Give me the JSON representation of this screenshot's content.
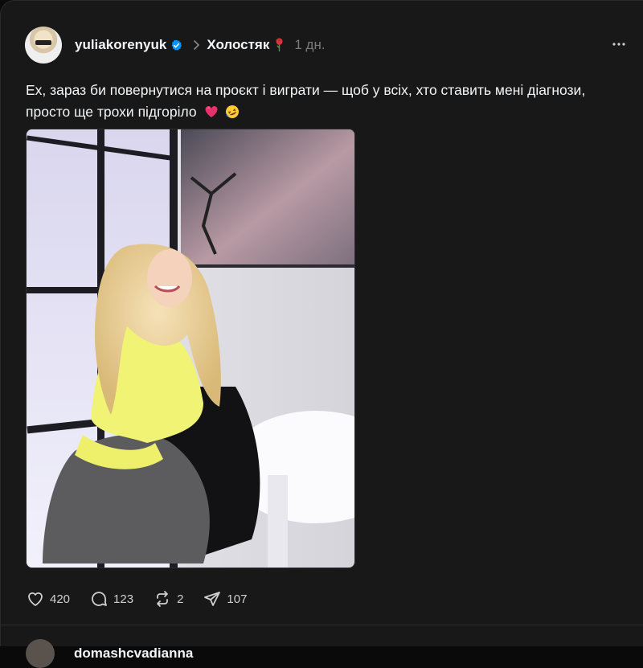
{
  "post": {
    "username": "yuliakorenyuk",
    "community": "Холостяк",
    "time": "1 дн.",
    "text_line1": "Ех, зараз би повернутися на проєкт і виграти — щоб у всіх, хто ставить мені діагнози,",
    "text_line2": "просто ще трохи підгоріло",
    "icons": {
      "verified": "verified-badge-icon",
      "chevron": "chevron-right-icon",
      "community_emoji": "rose-icon",
      "more": "more-horizontal-icon",
      "emoji1": "heart-emoji-icon",
      "emoji2": "rofl-emoji-icon"
    },
    "stats": {
      "likes": "420",
      "replies": "123",
      "reposts": "2",
      "shares": "107"
    }
  },
  "next_post": {
    "username": "domashcvadianna"
  },
  "colors": {
    "background": "#181818",
    "verified": "#0095f6",
    "text": "#f3f5f7",
    "muted": "#7a7a7a"
  }
}
